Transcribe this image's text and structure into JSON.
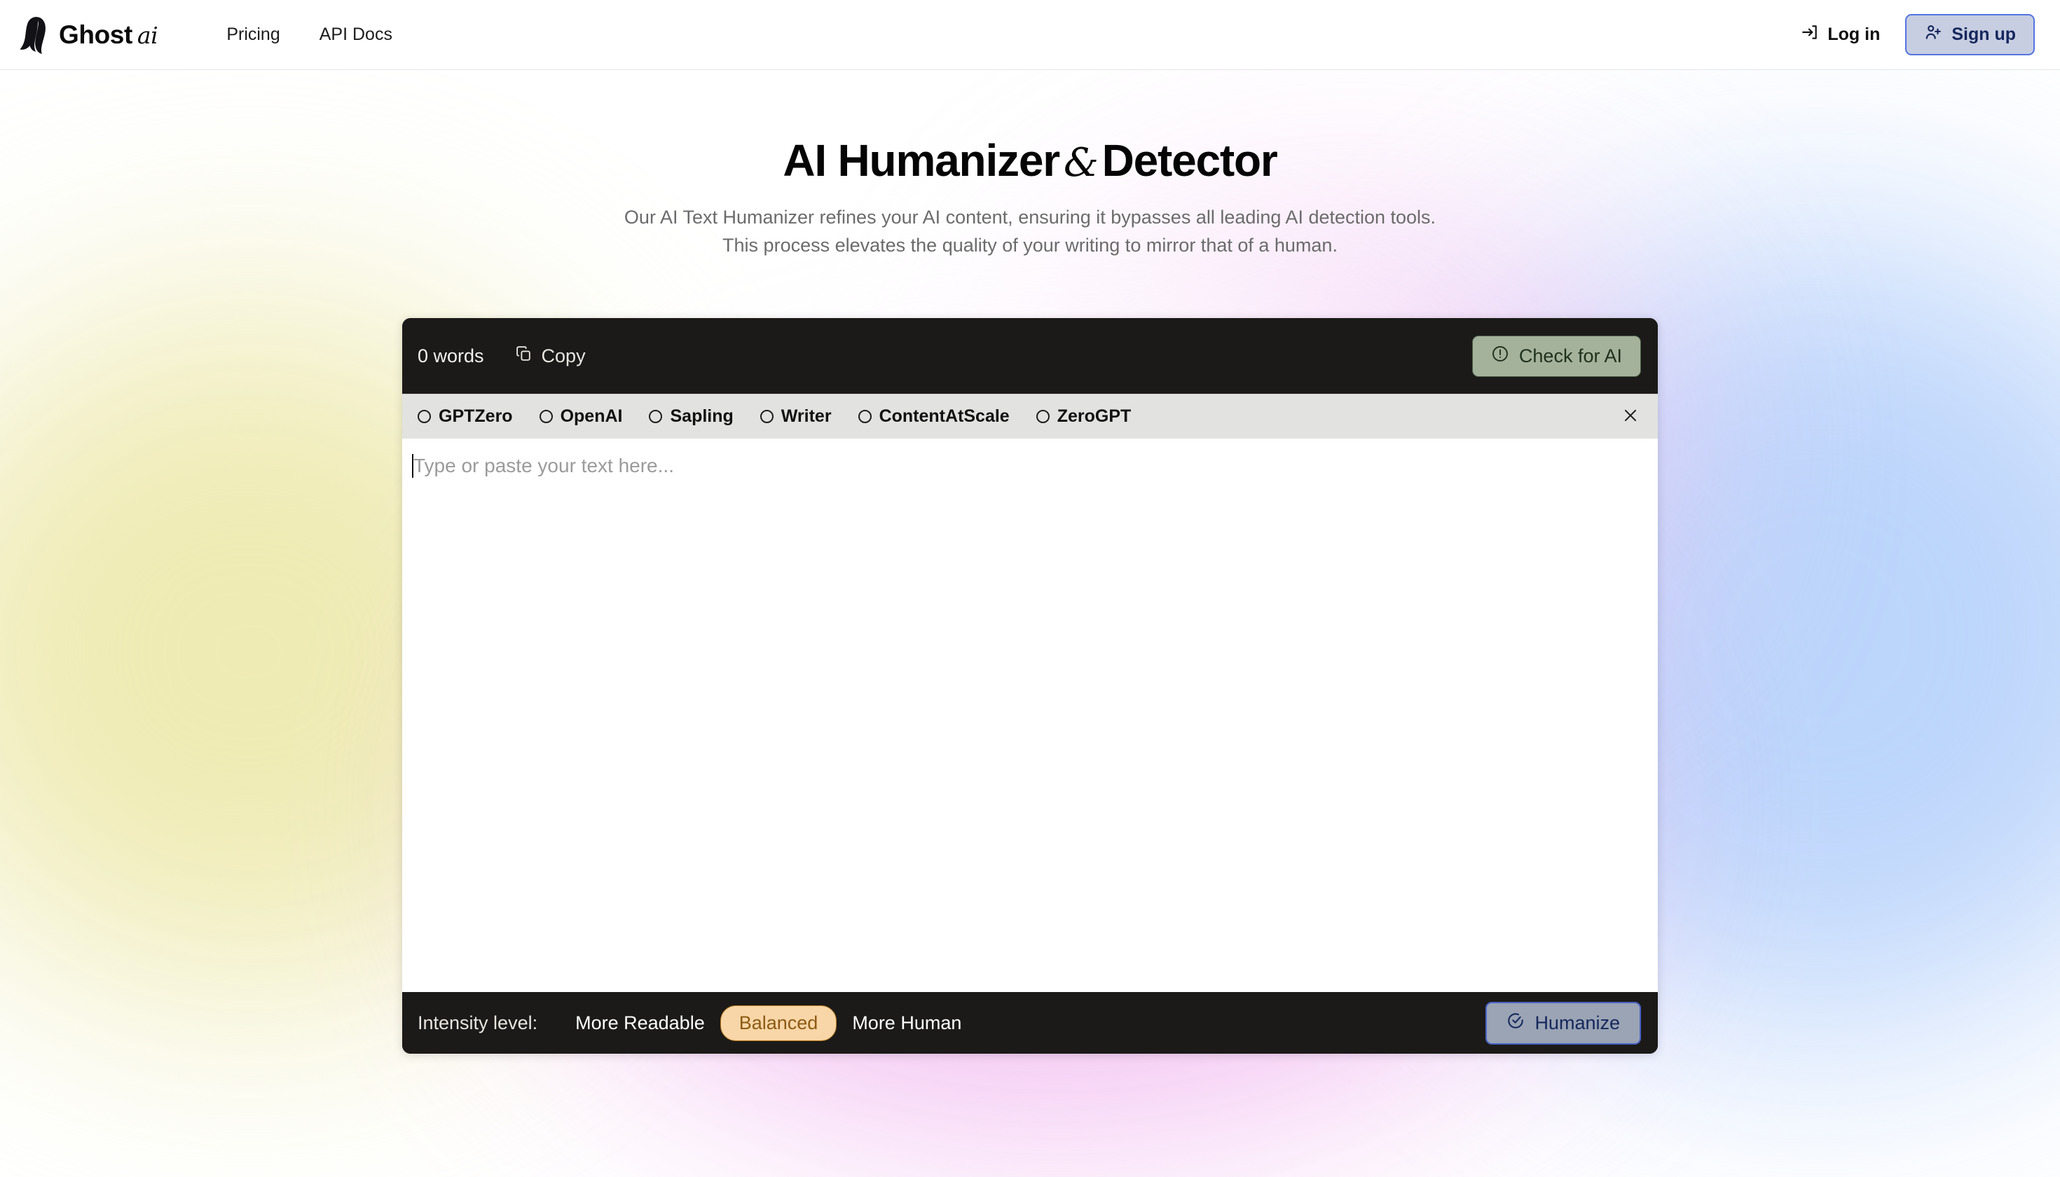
{
  "header": {
    "brand": {
      "name": "Ghost",
      "suffix": "ai",
      "logo_icon": "ghost-icon"
    },
    "nav": [
      {
        "label": "Pricing"
      },
      {
        "label": "API Docs"
      }
    ],
    "login": {
      "label": "Log in",
      "icon": "login-arrow-icon"
    },
    "signup": {
      "label": "Sign up",
      "icon": "user-plus-icon"
    }
  },
  "hero": {
    "title_part1": "AI Humanizer",
    "title_amp": "&",
    "title_part2": "Detector",
    "subtitle_line1": "Our AI Text Humanizer refines your AI content, ensuring it bypasses all leading AI detection tools.",
    "subtitle_line2": "This process elevates the quality of your writing to mirror that of a human."
  },
  "editor": {
    "toolbar": {
      "word_count": "0 words",
      "copy_label": "Copy",
      "copy_icon": "copy-icon",
      "check_ai_label": "Check for AI",
      "check_ai_icon": "alert-circle-icon"
    },
    "detectors": [
      {
        "label": "GPTZero",
        "state": "unchecked"
      },
      {
        "label": "OpenAI",
        "state": "unchecked"
      },
      {
        "label": "Sapling",
        "state": "unchecked"
      },
      {
        "label": "Writer",
        "state": "unchecked"
      },
      {
        "label": "ContentAtScale",
        "state": "unchecked"
      },
      {
        "label": "ZeroGPT",
        "state": "unchecked"
      }
    ],
    "close_icon": "close-icon",
    "textarea": {
      "value": "",
      "placeholder": "Type or paste your text here..."
    },
    "bottom": {
      "intensity_label": "Intensity level:",
      "options": [
        {
          "label": "More Readable",
          "selected": false
        },
        {
          "label": "Balanced",
          "selected": true
        },
        {
          "label": "More Human",
          "selected": false
        }
      ],
      "humanize_label": "Humanize",
      "humanize_icon": "check-circle-icon"
    }
  },
  "colors": {
    "card_dark": "#1b1a18",
    "check_ai_green": "#a4b29c",
    "balanced_peach": "#f9d6a7",
    "humanize_blue_grey": "#9aa4b4",
    "signup_blue_grey": "#c7cee2",
    "accent_blue_border": "#5573e0",
    "glow_yellow": "#eeeab0",
    "glow_blue": "#b9d3fb",
    "glow_pink": "#f0b6ef"
  }
}
